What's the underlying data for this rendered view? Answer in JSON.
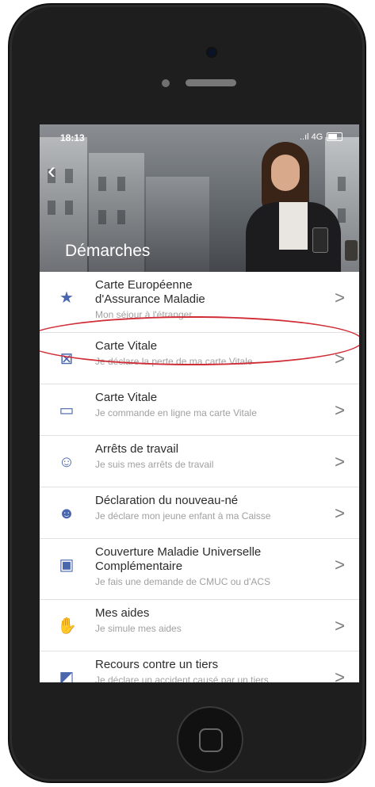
{
  "status": {
    "time": "18:13",
    "signal": "..ıl 4G"
  },
  "header": {
    "back_icon": "‹",
    "title": "Démarches"
  },
  "items": [
    {
      "title": "Carte Européenne",
      "title2": "d'Assurance Maladie",
      "subtitle": "Mon séjour à l'étranger",
      "icon": "eu-card-icon",
      "chevron": ">"
    },
    {
      "title": "Carte Vitale",
      "subtitle": "Je déclare la perte de ma carte Vitale",
      "icon": "lost-card-icon",
      "chevron": ">"
    },
    {
      "title": "Carte Vitale",
      "subtitle": "Je commande en ligne ma carte Vitale",
      "icon": "card-icon",
      "chevron": ">"
    },
    {
      "title": "Arrêts de travail",
      "subtitle": "Je suis mes arrêts de travail",
      "icon": "sick-leave-icon",
      "chevron": ">"
    },
    {
      "title": "Déclaration du nouveau-né",
      "subtitle": "Je déclare mon jeune enfant à ma Caisse",
      "icon": "newborn-icon",
      "chevron": ">"
    },
    {
      "title": "Couverture Maladie Universelle",
      "title2": "Complémentaire",
      "subtitle": "Je fais une demande de CMUC ou d'ACS",
      "icon": "cmu-icon",
      "chevron": ">"
    },
    {
      "title": "Mes aides",
      "subtitle": "Je simule mes aides",
      "icon": "aids-icon",
      "chevron": ">"
    },
    {
      "title": "Recours contre un tiers",
      "subtitle": "Je déclare un accident causé par un tiers",
      "icon": "claim-icon",
      "chevron": ">"
    }
  ],
  "colors": {
    "accent": "#4a66ad",
    "highlight": "#d02d37"
  }
}
